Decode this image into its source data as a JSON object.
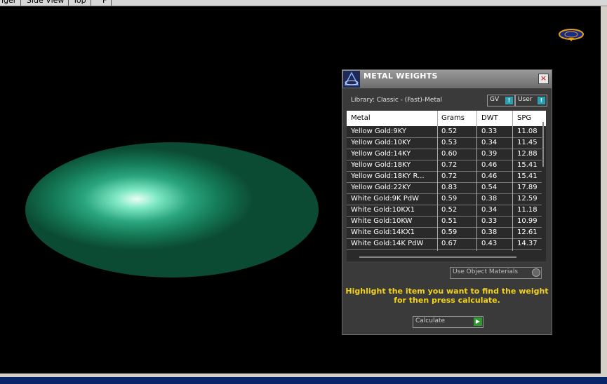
{
  "toolbar": {
    "tabs": [
      "nger",
      "Side View",
      "Top",
      "F"
    ]
  },
  "panel": {
    "title": "METAL WEIGHTS",
    "close_glyph": "×",
    "library_label": "Library: Classic - (Fast)-Metal",
    "gv_label": "GV",
    "user_label": "User",
    "toggle_glyph": "!",
    "use_object_label": "Use Object Materials",
    "hint_line1": "Highlight the item you want to find the weight",
    "hint_line2": "for then press calculate.",
    "calculate_label": "Calculate",
    "calculate_glyph": "▶"
  },
  "table": {
    "headers": [
      "Metal",
      "Grams",
      "DWT",
      "SPG"
    ],
    "rows": [
      [
        "Yellow Gold:9KY",
        "0.52",
        "0.33",
        "11.08"
      ],
      [
        "Yellow Gold:10KY",
        "0.53",
        "0.34",
        "11.45"
      ],
      [
        "Yellow Gold:14KY",
        "0.60",
        "0.39",
        "12.88"
      ],
      [
        "Yellow Gold:18KY",
        "0.72",
        "0.46",
        "15.41"
      ],
      [
        "Yellow Gold:18KY R...",
        "0.72",
        "0.46",
        "15.41"
      ],
      [
        "Yellow Gold:22KY",
        "0.83",
        "0.54",
        "17.89"
      ],
      [
        "White Gold:9K PdW",
        "0.59",
        "0.38",
        "12.59"
      ],
      [
        "White Gold:10KX1",
        "0.52",
        "0.34",
        "11.18"
      ],
      [
        "White Gold:10KW",
        "0.51",
        "0.33",
        "10.99"
      ],
      [
        "White Gold:14KX1",
        "0.59",
        "0.38",
        "12.61"
      ],
      [
        "White Gold:14K PdW",
        "0.67",
        "0.43",
        "14.37"
      ]
    ]
  }
}
